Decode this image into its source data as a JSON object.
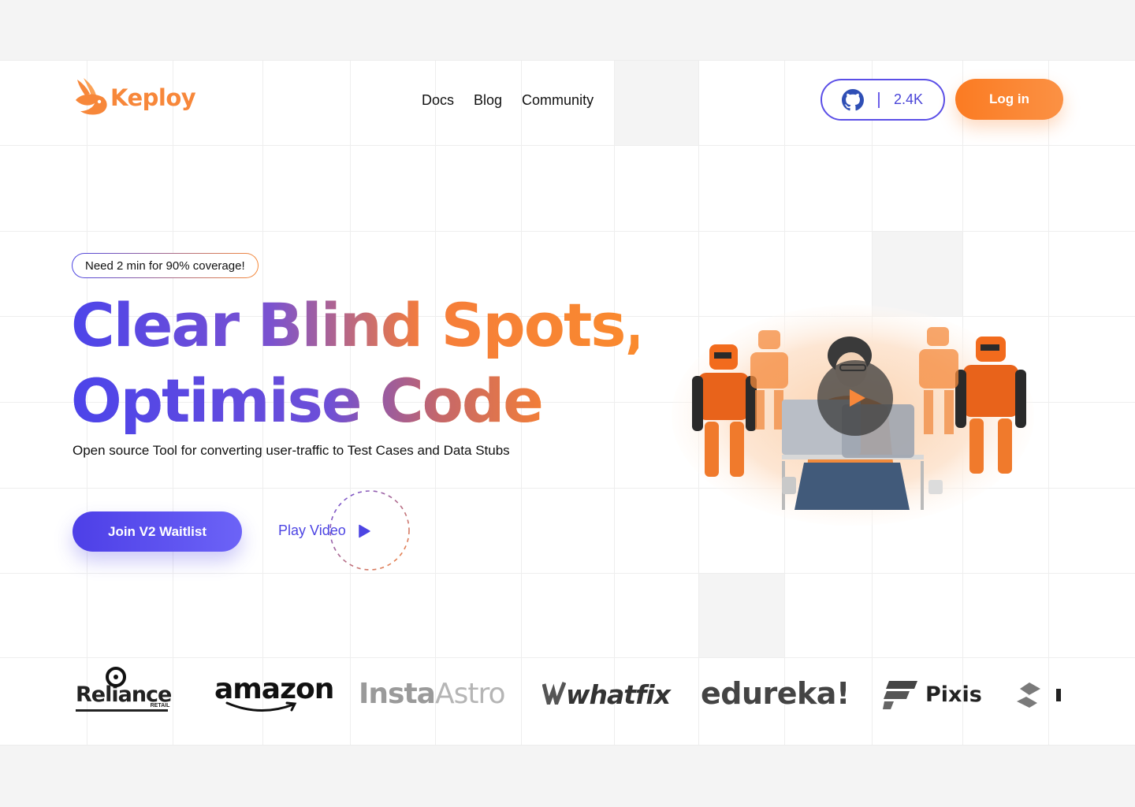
{
  "brand": {
    "name": "Keploy"
  },
  "nav": {
    "items": [
      "Docs",
      "Blog",
      "Community"
    ]
  },
  "github": {
    "stars": "2.4K"
  },
  "auth": {
    "login_label": "Log in"
  },
  "hero": {
    "badge": "Need 2 min for 90% coverage!",
    "headline_line1": "Clear Blind Spots,",
    "headline_line2": "Optimise Code",
    "subtitle": "Open source Tool for converting user-traffic to Test Cases and Data Stubs",
    "cta_label": "Join V2 Waitlist",
    "play_label": "Play Video"
  },
  "logos": {
    "reliance": "Reliance",
    "reliance_sub": "RETAIL",
    "amazon": "amazon",
    "insta": "Insta",
    "astro": "Astro",
    "whatfix": "whatfix",
    "edureka": "edureka!",
    "pixis": "Pixis"
  },
  "colors": {
    "primary": "#4d3fe7",
    "accent": "#fb7b22",
    "text": "#111111"
  },
  "icons": [
    "keploy-logo-icon",
    "github-icon",
    "play-icon",
    "suzuki-logo-icon"
  ]
}
